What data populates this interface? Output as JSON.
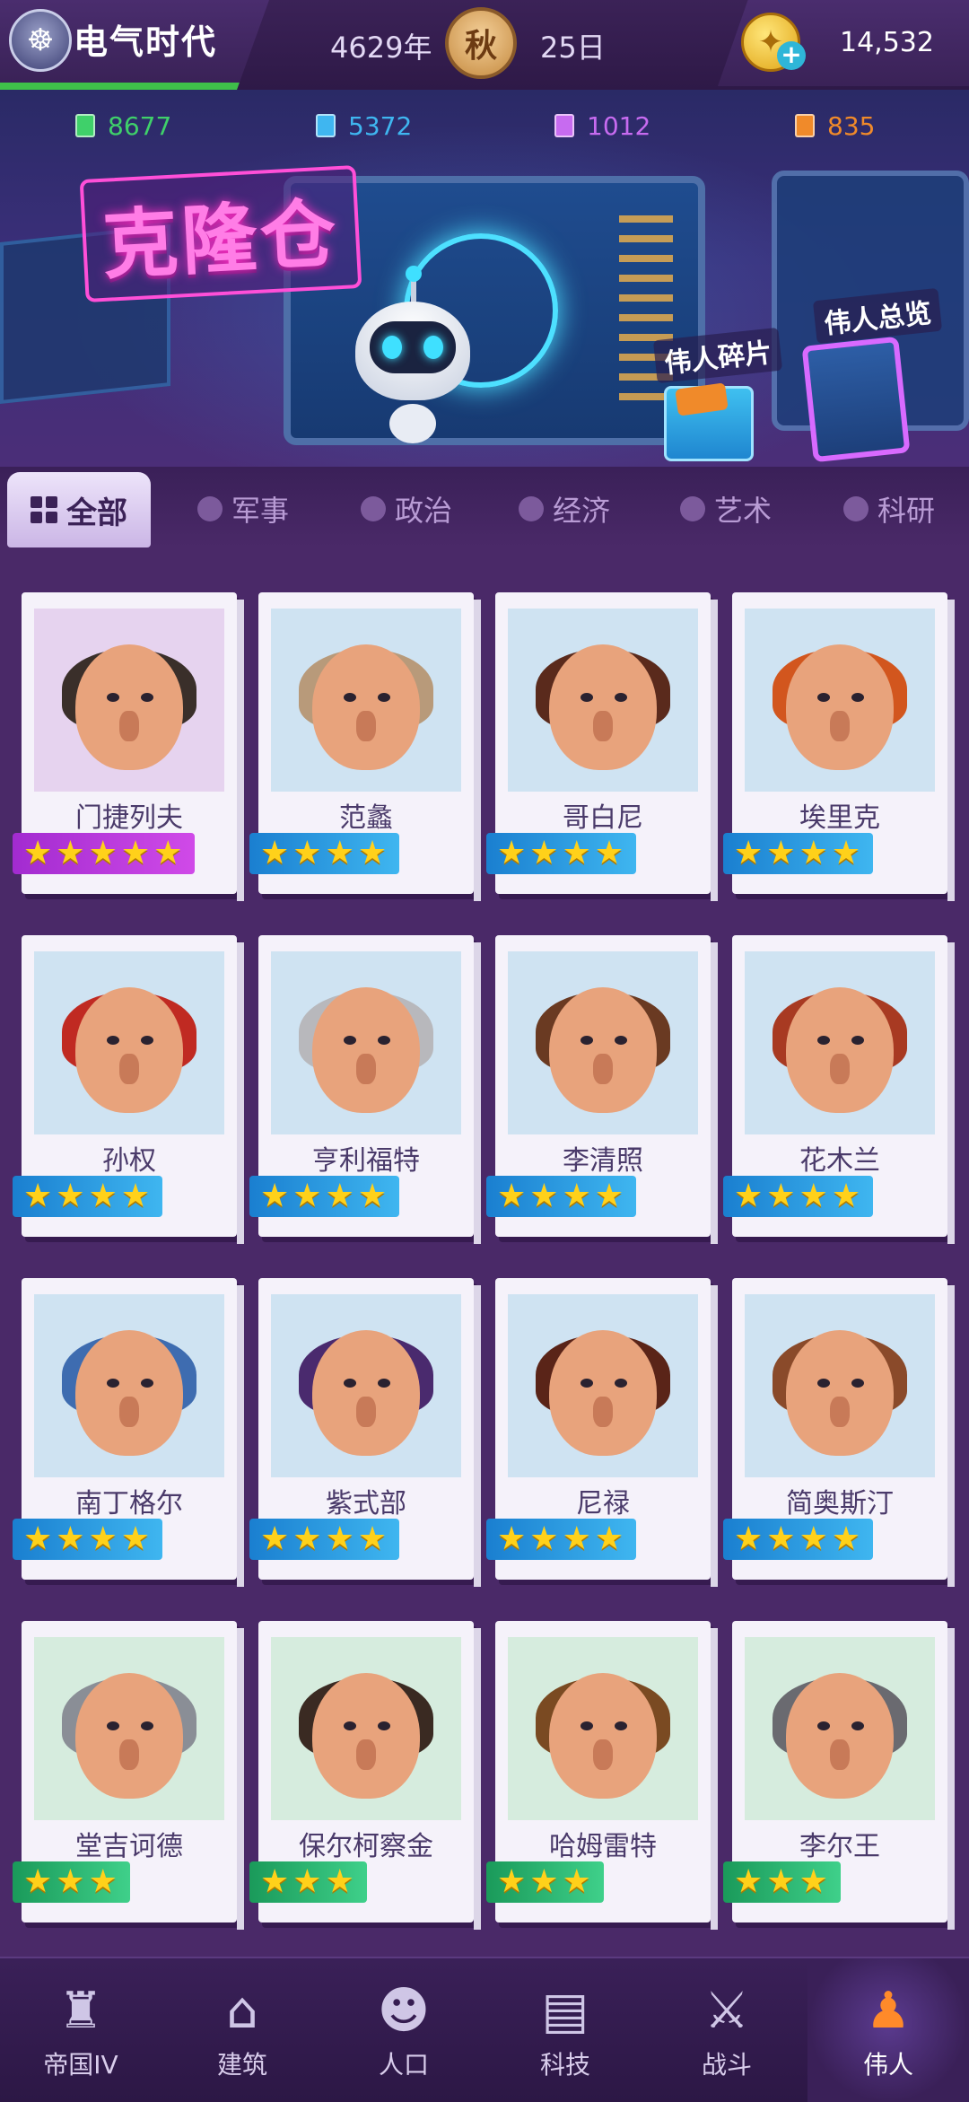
{
  "topbar": {
    "era": "电气时代",
    "year": "4629年",
    "season": "秋",
    "day": "25日",
    "gold": "14,532"
  },
  "resources": [
    {
      "value": "8677",
      "color": "#3fd06a",
      "icon": "green-crate-icon"
    },
    {
      "value": "5372",
      "color": "#3fb6f0",
      "icon": "blue-crate-icon"
    },
    {
      "value": "1012",
      "color": "#c76bf0",
      "icon": "purple-crate-icon"
    },
    {
      "value": "835",
      "color": "#f08a2a",
      "icon": "orange-crate-icon"
    }
  ],
  "banner": {
    "title": "克隆仓",
    "fragments_label": "伟人碎片",
    "overview_label": "伟人总览"
  },
  "tabs": [
    {
      "label": "全部",
      "active": true,
      "icon": "grid-icon"
    },
    {
      "label": "军事",
      "icon": "shield-icon"
    },
    {
      "label": "政治",
      "icon": "globe-icon"
    },
    {
      "label": "经济",
      "icon": "coins-icon"
    },
    {
      "label": "艺术",
      "icon": "palette-icon"
    },
    {
      "label": "科研",
      "icon": "flask-icon"
    }
  ],
  "greats": [
    {
      "name": "门捷列夫",
      "stars": 5,
      "hair": "#3a2f2a",
      "bg": "pink"
    },
    {
      "name": "范蠡",
      "stars": 4,
      "hair": "#b89a7a",
      "bg": "blue"
    },
    {
      "name": "哥白尼",
      "stars": 4,
      "hair": "#5a2a1c",
      "bg": "blue"
    },
    {
      "name": "埃里克",
      "stars": 4,
      "hair": "#d2561e",
      "bg": "blue"
    },
    {
      "name": "孙权",
      "stars": 4,
      "hair": "#c02a22",
      "bg": "blue"
    },
    {
      "name": "亨利福特",
      "stars": 4,
      "hair": "#b8b8bc",
      "bg": "blue"
    },
    {
      "name": "李清照",
      "stars": 4,
      "hair": "#6a3a22",
      "bg": "blue"
    },
    {
      "name": "花木兰",
      "stars": 4,
      "hair": "#a83a22",
      "bg": "blue"
    },
    {
      "name": "南丁格尔",
      "stars": 4,
      "hair": "#3e6cb0",
      "bg": "blue"
    },
    {
      "name": "紫式部",
      "stars": 4,
      "hair": "#4a2a6e",
      "bg": "blue"
    },
    {
      "name": "尼禄",
      "stars": 4,
      "hair": "#5a2418",
      "bg": "blue"
    },
    {
      "name": "简奥斯汀",
      "stars": 4,
      "hair": "#8a4a2a",
      "bg": "blue"
    },
    {
      "name": "堂吉诃德",
      "stars": 3,
      "hair": "#8a8e96",
      "bg": "green"
    },
    {
      "name": "保尔柯察金",
      "stars": 3,
      "hair": "#3a2a22",
      "bg": "green"
    },
    {
      "name": "哈姆雷特",
      "stars": 3,
      "hair": "#7a4a22",
      "bg": "green"
    },
    {
      "name": "李尔王",
      "stars": 3,
      "hair": "#6a6a70",
      "bg": "green"
    }
  ],
  "nav": [
    {
      "label": "帝国IV",
      "icon": "castle-icon",
      "glyph": "♜"
    },
    {
      "label": "建筑",
      "icon": "house-icon",
      "glyph": "⌂"
    },
    {
      "label": "人口",
      "icon": "person-icon",
      "glyph": "☻"
    },
    {
      "label": "科技",
      "icon": "book-icon",
      "glyph": "▤"
    },
    {
      "label": "战斗",
      "icon": "swords-icon",
      "glyph": "⚔"
    },
    {
      "label": "伟人",
      "icon": "statue-icon",
      "glyph": "♟",
      "active": true
    }
  ]
}
